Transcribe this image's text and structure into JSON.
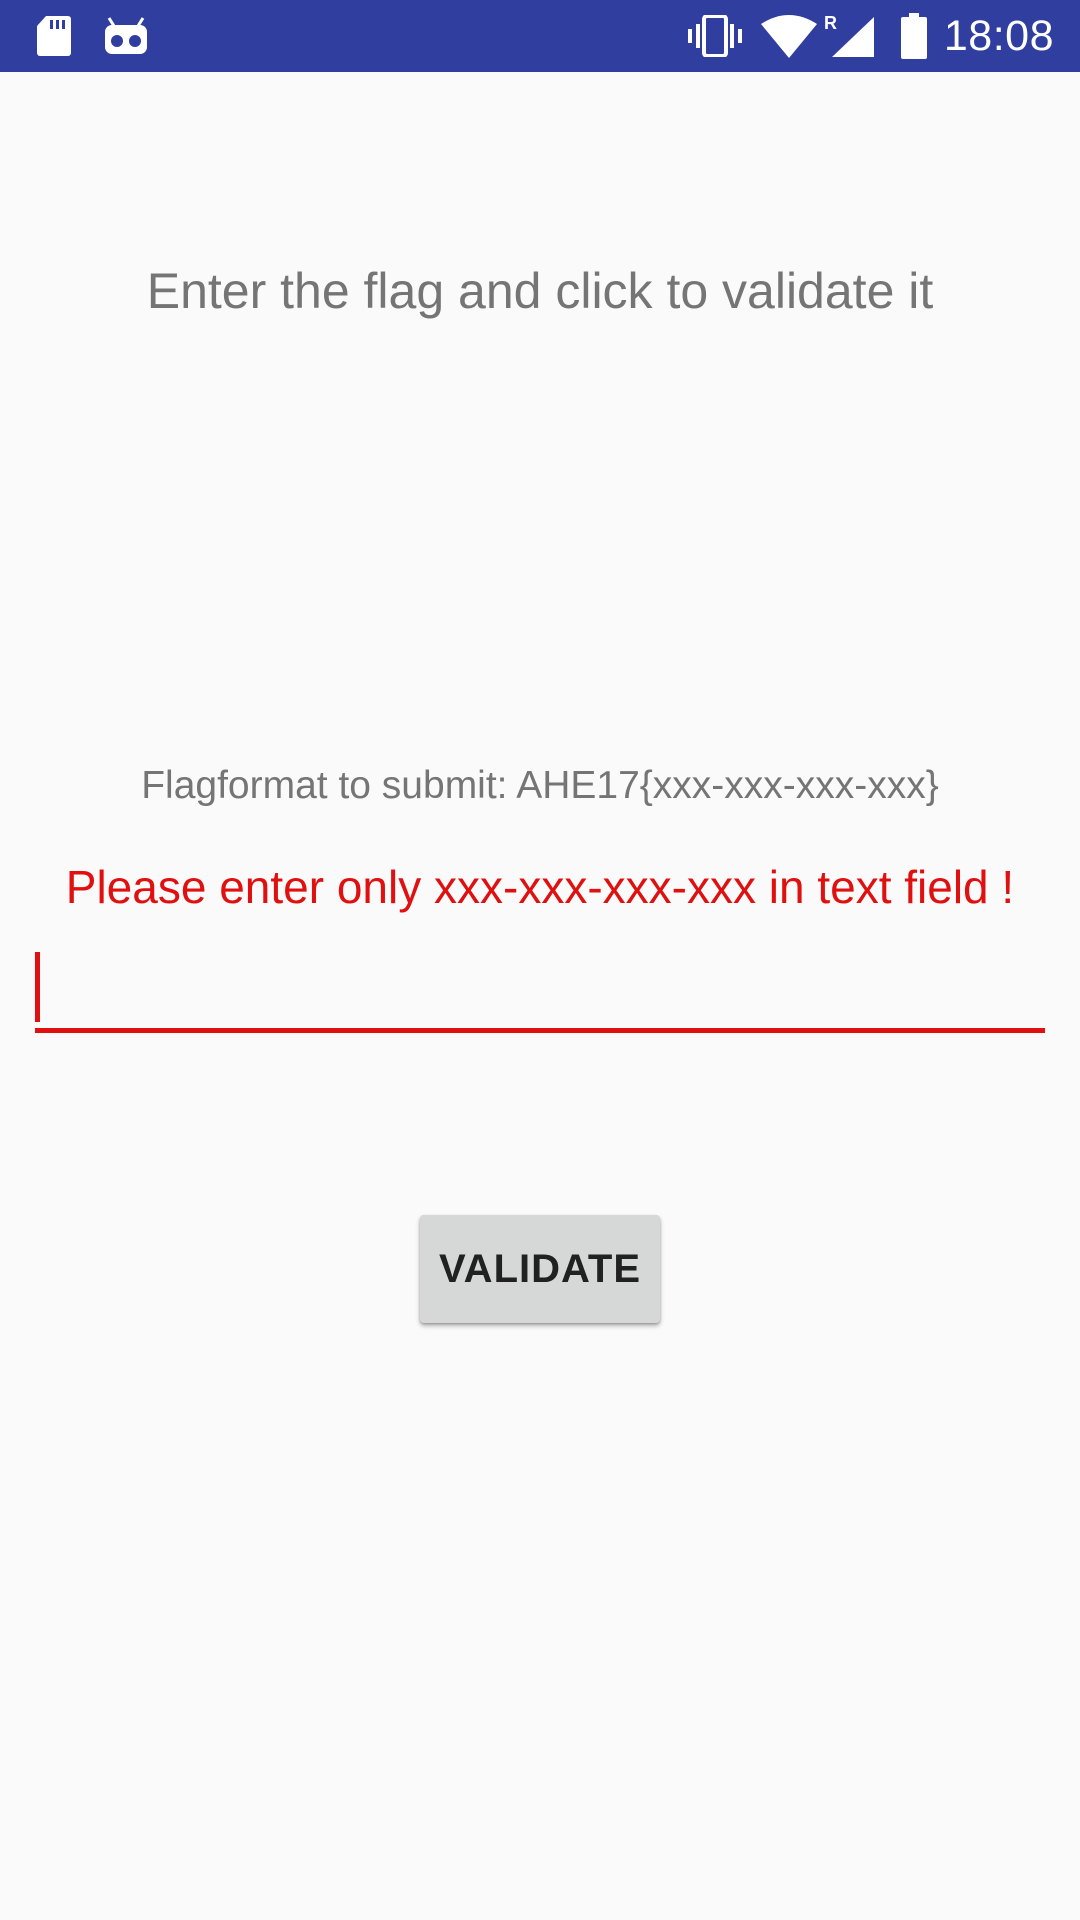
{
  "status_bar": {
    "time": "18:08",
    "background_color": "#303f9f",
    "icons": [
      "sd-card-icon",
      "debug-icon",
      "vibrate-icon",
      "wifi-icon",
      "signal-roaming-icon",
      "battery-icon"
    ],
    "roaming_indicator": "R"
  },
  "main": {
    "heading": "Enter the flag and click to validate it",
    "format_hint": "Flagformat to submit: AHE17{xxx-xxx-xxx-xxx}",
    "error_message": "Please enter only xxx-xxx-xxx-xxx in text field !",
    "flag_input": {
      "value": "",
      "placeholder": ""
    },
    "validate_button_label": "VALIDATE"
  },
  "colors": {
    "background": "#fafafa",
    "text_secondary": "#757575",
    "error": "#e01010",
    "button": "#d6d7d7"
  }
}
